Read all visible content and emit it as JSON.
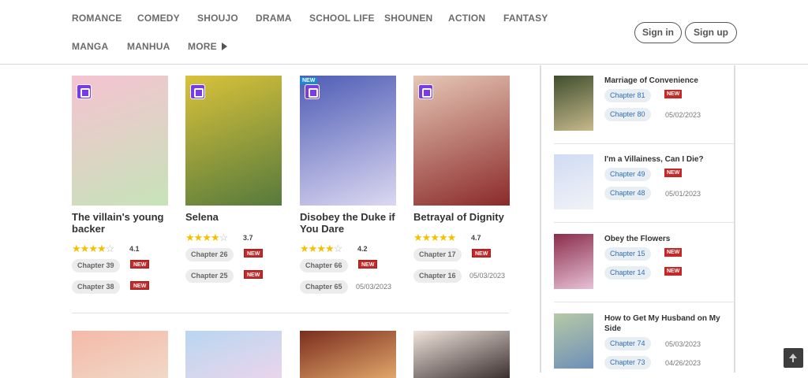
{
  "nav": {
    "row1": [
      "ROMANCE",
      "COMEDY",
      "SHOUJO",
      "DRAMA",
      "SCHOOL LIFE",
      "SHOUNEN",
      "ACTION",
      "FANTASY"
    ],
    "row2": [
      "MANGA",
      "MANHUA",
      "MORE"
    ]
  },
  "auth": {
    "signin": "Sign in",
    "signup": "Sign up"
  },
  "cards": [
    {
      "title": "The villain's young backer",
      "rating": "4.1",
      "stars": 4.1,
      "chapters": [
        {
          "label": "Chapter 39",
          "badge": "NEW",
          "date": ""
        },
        {
          "label": "Chapter 38",
          "badge": "NEW",
          "date": ""
        }
      ],
      "colors": [
        "#f6c3d2",
        "#c6e3b8"
      ]
    },
    {
      "title": "Selena",
      "rating": "3.7",
      "stars": 3.7,
      "chapters": [
        {
          "label": "Chapter 26",
          "badge": "NEW",
          "date": ""
        },
        {
          "label": "Chapter 25",
          "badge": "NEW",
          "date": ""
        }
      ],
      "colors": [
        "#d9c23a",
        "#567a3c"
      ]
    },
    {
      "title": "Disobey the Duke if You Dare",
      "rating": "4.2",
      "stars": 4.2,
      "chapters": [
        {
          "label": "Chapter 66",
          "badge": "NEW",
          "date": ""
        },
        {
          "label": "Chapter 65",
          "badge": "",
          "date": "05/03/2023"
        }
      ],
      "colors": [
        "#4e5db5",
        "#dcd8f2"
      ],
      "cover_badge": "NEW"
    },
    {
      "title": "Betrayal of Dignity",
      "rating": "4.7",
      "stars": 4.7,
      "chapters": [
        {
          "label": "Chapter 17",
          "badge": "NEW",
          "date": ""
        },
        {
          "label": "Chapter 16",
          "badge": "",
          "date": "05/03/2023"
        }
      ],
      "colors": [
        "#e6c7b6",
        "#8b2a2a"
      ]
    }
  ],
  "bottom_covers": [
    {
      "colors": [
        "#f4b9a8",
        "#f1d8c8"
      ]
    },
    {
      "colors": [
        "#b8d6f0",
        "#ead5ec"
      ]
    },
    {
      "colors": [
        "#7a2d1e",
        "#e0a66a"
      ]
    },
    {
      "colors": [
        "#f0e4dc",
        "#3b3030"
      ]
    }
  ],
  "sidebar": [
    {
      "title": "Marriage of Convenience",
      "colors": [
        "#3f4e2e",
        "#c7b98c"
      ],
      "chapters": [
        {
          "label": "Chapter 81",
          "badge": "NEW",
          "date": ""
        },
        {
          "label": "Chapter 80",
          "badge": "",
          "date": "05/02/2023"
        }
      ]
    },
    {
      "title": "I'm a Villainess, Can I Die?",
      "colors": [
        "#cfdcf3",
        "#f2f2f7"
      ],
      "chapters": [
        {
          "label": "Chapter 49",
          "badge": "NEW",
          "date": ""
        },
        {
          "label": "Chapter 48",
          "badge": "",
          "date": "05/01/2023"
        }
      ]
    },
    {
      "title": "Obey the Flowers",
      "colors": [
        "#8b2d4b",
        "#e7c1d6"
      ],
      "chapters": [
        {
          "label": "Chapter 15",
          "badge": "NEW",
          "date": ""
        },
        {
          "label": "Chapter 14",
          "badge": "NEW",
          "date": ""
        }
      ]
    },
    {
      "title": "How to Get My Husband on My Side",
      "colors": [
        "#b6c9a6",
        "#6f8fb8"
      ],
      "chapters": [
        {
          "label": "Chapter 74",
          "badge": "",
          "date": "05/03/2023"
        },
        {
          "label": "Chapter 73",
          "badge": "",
          "date": "04/26/2023"
        }
      ]
    }
  ]
}
